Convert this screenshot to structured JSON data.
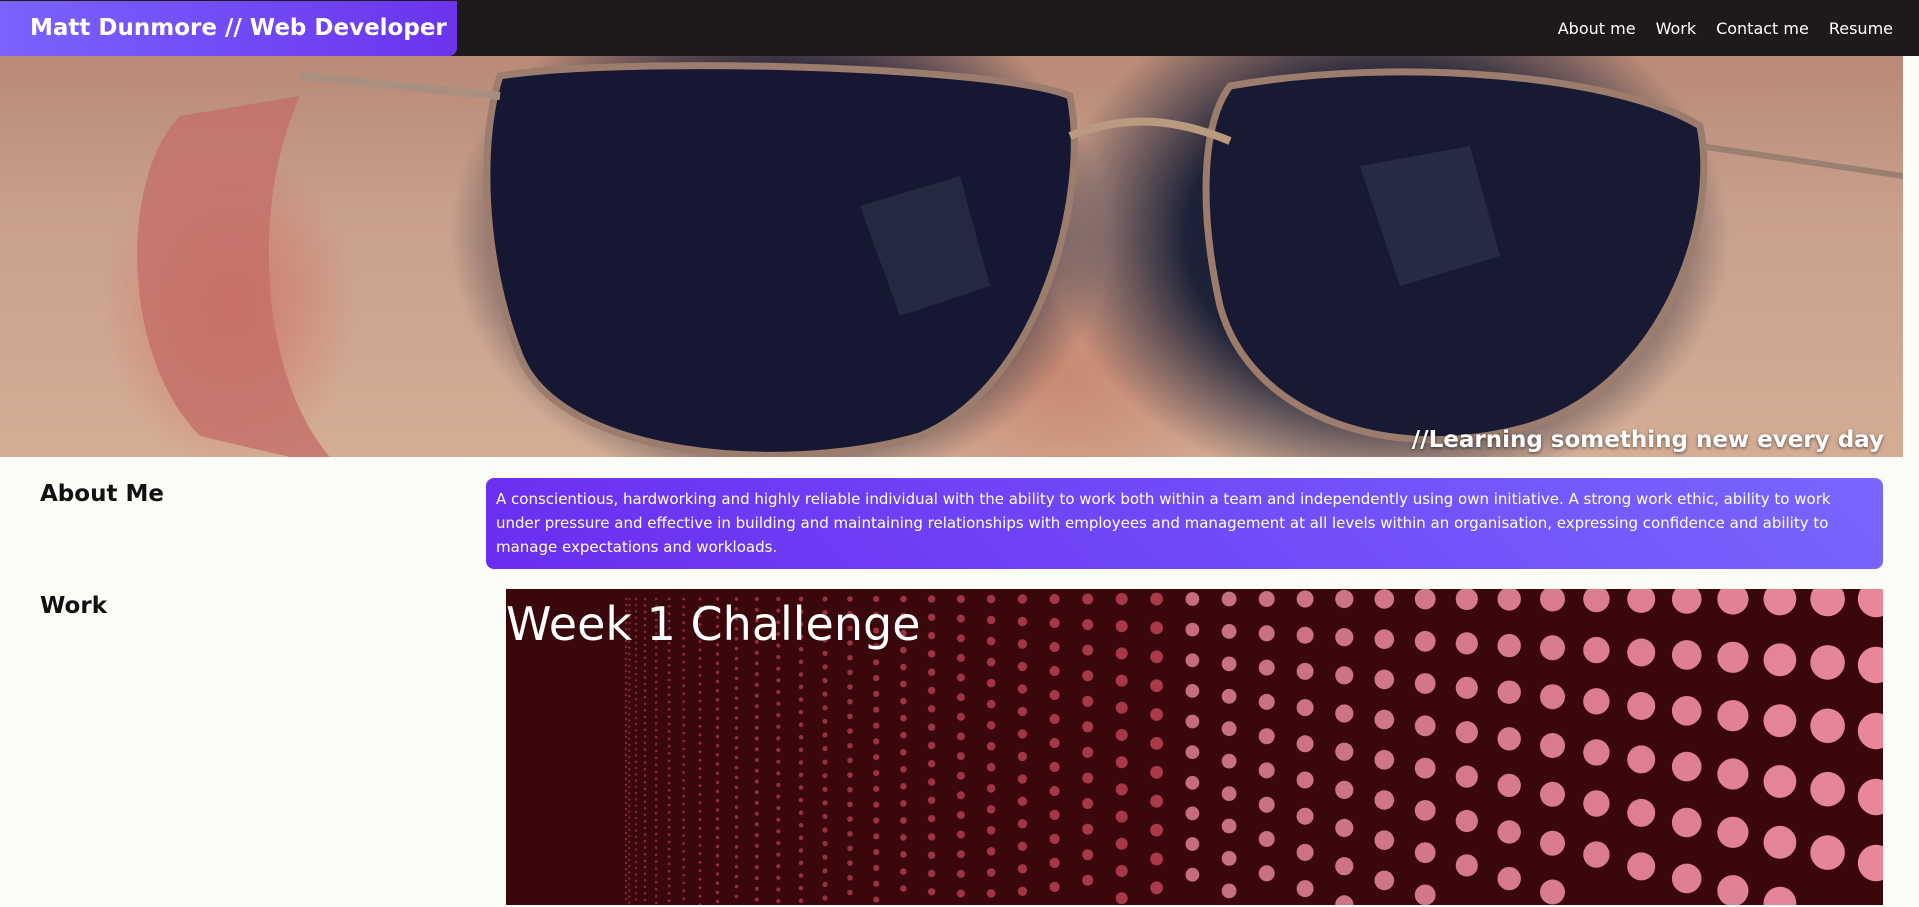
{
  "header": {
    "brand": "Matt Dunmore // Web Developer",
    "nav": [
      "About me",
      "Work",
      "Contact me",
      "Resume"
    ]
  },
  "hero": {
    "caption": "//Learning something new every day"
  },
  "about": {
    "title": "About Me",
    "text": "A conscientious, hardworking and highly reliable individual with the ability to work both within a team and independently using own initiative. A strong work ethic, ability to work under pressure and effective in building and maintaining relationships with employees and management at all levels within an organisation, expressing confidence and ability to manage expectations and workloads."
  },
  "work": {
    "title": "Work",
    "projects": [
      {
        "title": "Week 1 Challenge"
      }
    ]
  },
  "colors": {
    "header_bg": "#1e1a1b",
    "accent_start": "#7a63ff",
    "accent_end": "#6a2df0",
    "page_bg": "#fbfcf8"
  }
}
